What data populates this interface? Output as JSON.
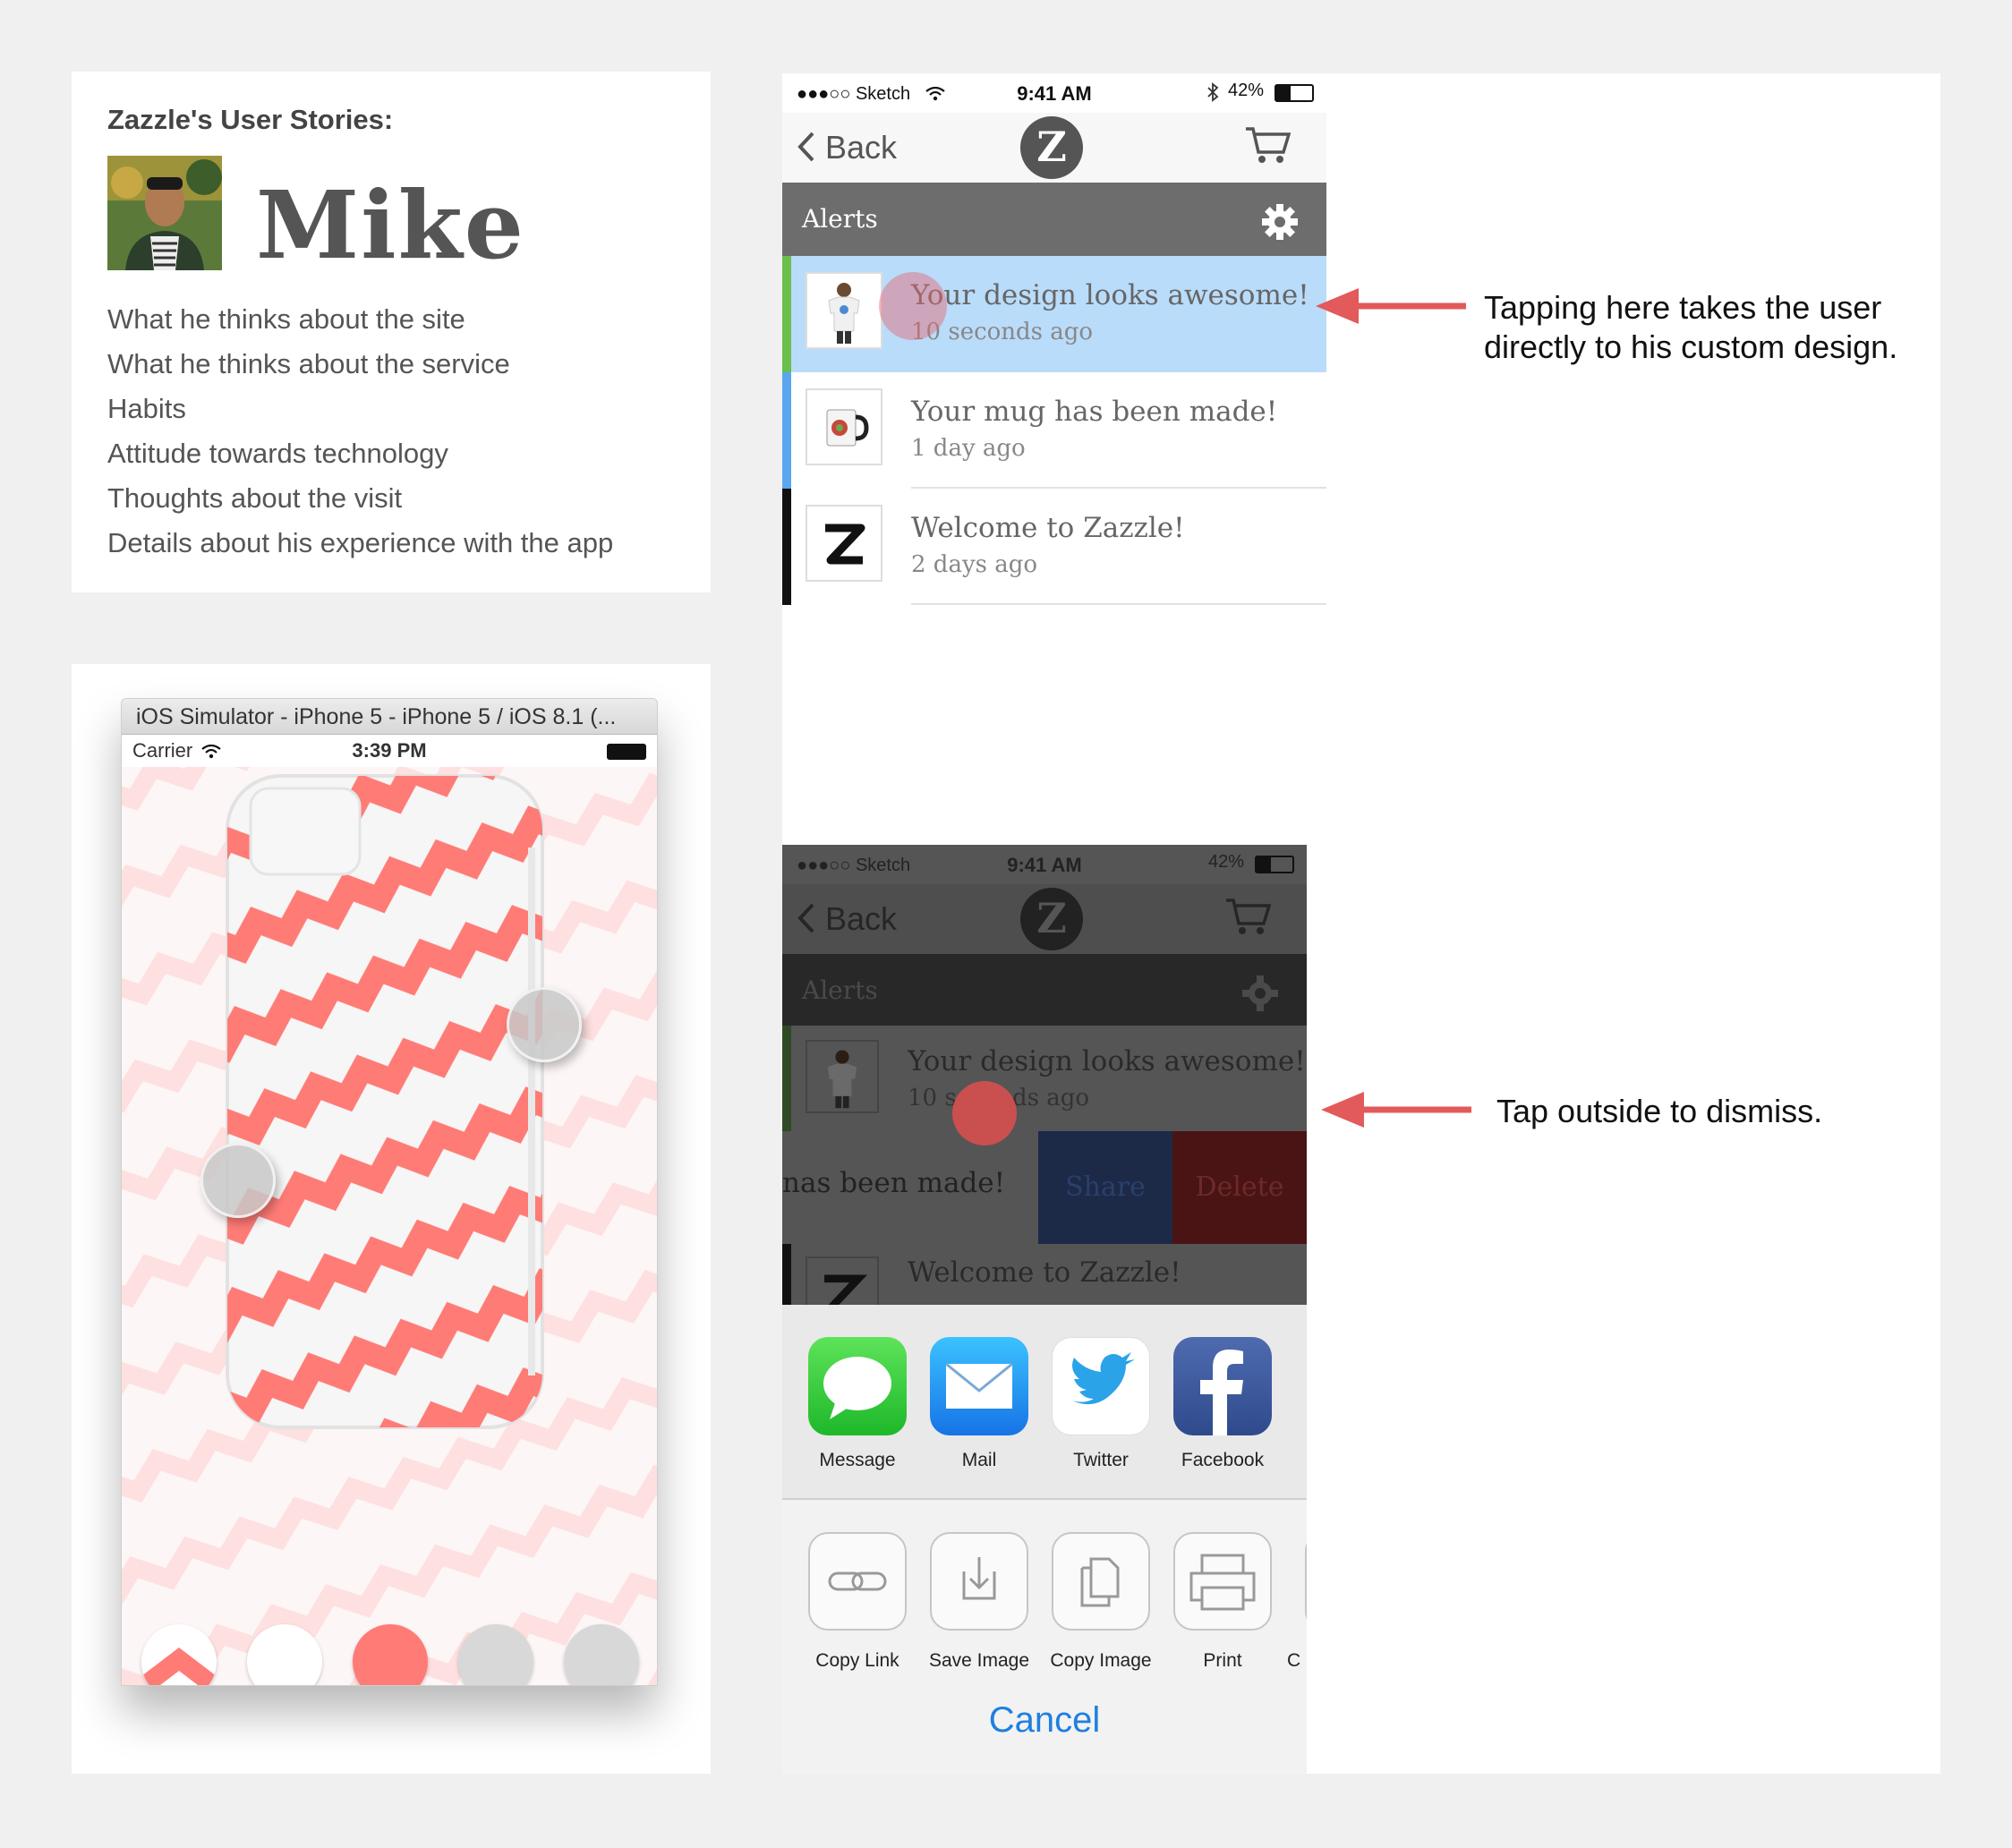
{
  "persona": {
    "title": "Zazzle's User Stories:",
    "name": "Mike",
    "items": [
      "What he thinks about the site",
      "What he thinks about the service",
      "Habits",
      "Attitude towards technology",
      "Thoughts about the visit",
      "Details about his experience with the app"
    ]
  },
  "simulator": {
    "window_title": "iOS Simulator - iPhone 5 - iPhone 5 / iOS 8.1 (...",
    "carrier": "Carrier",
    "time": "3:39 PM",
    "colors": {
      "pattern": "#ff7b76",
      "pattern_light": "#fde3e2",
      "background": "#fdf4f4"
    },
    "swatches": [
      "chevron",
      "#ffffff",
      "#ff7b76",
      "#d8d8d8",
      "#d8d8d8"
    ]
  },
  "app": {
    "status": {
      "signal": "●●●○○ Sketch",
      "time": "9:41 AM",
      "battery_pct": "42%"
    },
    "back_label": "Back",
    "logo_letter": "Z",
    "alerts_title": "Alerts",
    "alerts": [
      {
        "message": "Your design looks awesome!",
        "ago": "10 seconds ago",
        "accent": "#6cbf4a",
        "highlight": "#b9dcfa",
        "thumb": "tshirt-icon"
      },
      {
        "message": "Your mug has been made!",
        "ago": "1 day ago",
        "accent": "#5aa7f0",
        "highlight": "#ffffff",
        "thumb": "mug-icon"
      },
      {
        "message": "Welcome to Zazzle!",
        "ago": "2 days ago",
        "accent": "#111111",
        "highlight": "#ffffff",
        "thumb": "zazzle-logo-icon"
      }
    ]
  },
  "annotations": {
    "tap_note_1": "Tapping here takes the user",
    "tap_note_2": "directly to his custom design.",
    "dismiss_note": "Tap outside to dismiss.",
    "arrow_color": "#e25a5a"
  },
  "share_sheet": {
    "swipe_text": "nas been made!",
    "share_label": "Share",
    "delete_label": "Delete",
    "apps": [
      {
        "label": "Message",
        "icon": "message-icon",
        "color": "#2ecc40"
      },
      {
        "label": "Mail",
        "icon": "mail-icon",
        "color": "#1a9bf0"
      },
      {
        "label": "Twitter",
        "icon": "twitter-icon",
        "color": "#ffffff"
      },
      {
        "label": "Facebook",
        "icon": "facebook-icon",
        "color": "#3b5998"
      }
    ],
    "actions": [
      {
        "label": "Copy Link",
        "icon": "link-icon"
      },
      {
        "label": "Save Image",
        "icon": "download-icon"
      },
      {
        "label": "Copy Image",
        "icon": "copy-icon"
      },
      {
        "label": "Print",
        "icon": "print-icon"
      },
      {
        "label": "C",
        "icon": "more-icon"
      }
    ],
    "cancel_label": "Cancel"
  }
}
